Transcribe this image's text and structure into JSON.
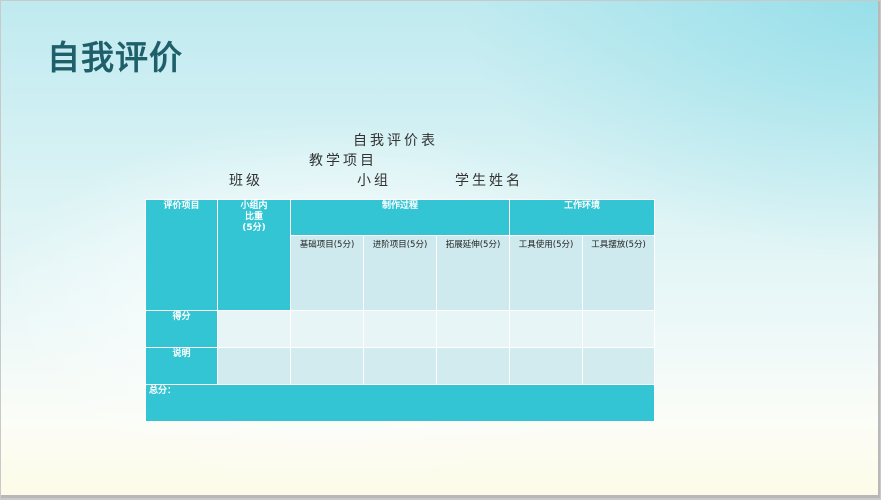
{
  "slide": {
    "title": "自我评价",
    "form_title": "自我评价表",
    "project_label": "教学项目",
    "class_label": "班级",
    "group_label": "小组",
    "student_label": "学生姓名"
  },
  "table": {
    "h_item": "评价项目",
    "h_weight_1": "小组内",
    "h_weight_2": "比重",
    "h_weight_3": "(5分)",
    "h_process": "制作过程",
    "h_env": "工作环境",
    "sub": [
      "基础项目(5分)",
      "进阶项目(5分)",
      "拓展延伸(5分)",
      "工具使用(5分)",
      "工具摆放(5分)"
    ],
    "row_score": "得分",
    "row_note": "说明",
    "total": "总分："
  },
  "colors": {
    "teal": "#33c5d4",
    "title": "#1f5f6a",
    "light": "#cfeaee"
  }
}
